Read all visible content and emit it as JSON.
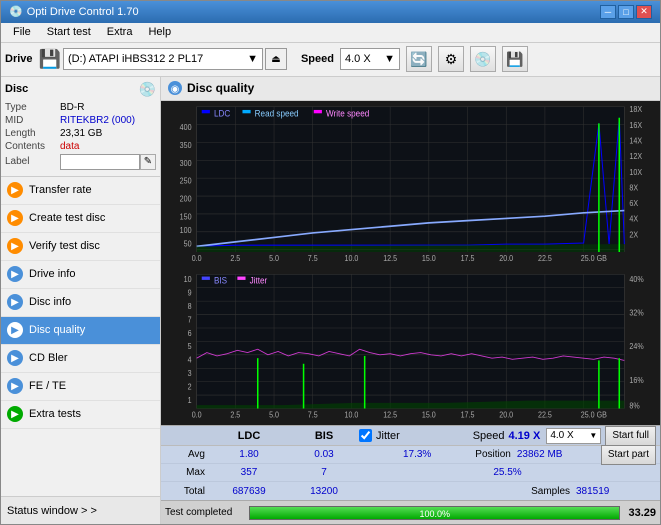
{
  "app": {
    "title": "Opti Drive Control 1.70",
    "icon": "💿"
  },
  "titlebar": {
    "minimize": "─",
    "maximize": "□",
    "close": "✕"
  },
  "menu": {
    "items": [
      "File",
      "Start test",
      "Extra",
      "Help"
    ]
  },
  "drivebar": {
    "drive_label": "Drive",
    "drive_value": "(D:) ATAPI iHBS312  2 PL17",
    "speed_label": "Speed",
    "speed_value": "4.0 X"
  },
  "disc": {
    "title": "Disc",
    "type_label": "Type",
    "type_value": "BD-R",
    "mid_label": "MID",
    "mid_value": "RITEKBR2 (000)",
    "length_label": "Length",
    "length_value": "23,31 GB",
    "contents_label": "Contents",
    "contents_value": "data",
    "label_label": "Label",
    "label_value": ""
  },
  "sidebar": {
    "items": [
      {
        "id": "transfer-rate",
        "label": "Transfer rate",
        "icon": "▶",
        "color": "orange"
      },
      {
        "id": "create-test-disc",
        "label": "Create test disc",
        "icon": "▶",
        "color": "orange"
      },
      {
        "id": "verify-test-disc",
        "label": "Verify test disc",
        "icon": "▶",
        "color": "orange"
      },
      {
        "id": "drive-info",
        "label": "Drive info",
        "icon": "▶",
        "color": "blue"
      },
      {
        "id": "disc-info",
        "label": "Disc info",
        "icon": "▶",
        "color": "blue"
      },
      {
        "id": "disc-quality",
        "label": "Disc quality",
        "icon": "▶",
        "color": "active",
        "active": true
      },
      {
        "id": "cd-bler",
        "label": "CD Bler",
        "icon": "▶",
        "color": "blue"
      },
      {
        "id": "fe-te",
        "label": "FE / TE",
        "icon": "▶",
        "color": "blue"
      },
      {
        "id": "extra-tests",
        "label": "Extra tests",
        "icon": "▶",
        "color": "green"
      }
    ],
    "status_window": "Status window > >"
  },
  "disc_quality": {
    "title": "Disc quality",
    "legend": {
      "ldc": "LDC",
      "read_speed": "Read speed",
      "write_speed": "Write speed",
      "bis": "BIS",
      "jitter": "Jitter"
    },
    "upper_chart": {
      "y_left_max": 400,
      "y_left_labels": [
        "400",
        "350",
        "300",
        "250",
        "200",
        "150",
        "100",
        "50"
      ],
      "y_right_labels": [
        "18X",
        "16X",
        "14X",
        "12X",
        "10X",
        "8X",
        "6X",
        "4X",
        "2X"
      ],
      "x_labels": [
        "0.0",
        "2.5",
        "5.0",
        "7.5",
        "10.0",
        "12.5",
        "15.0",
        "17.5",
        "20.0",
        "22.5",
        "25.0 GB"
      ]
    },
    "lower_chart": {
      "y_left_labels": [
        "10",
        "9",
        "8",
        "7",
        "6",
        "5",
        "4",
        "3",
        "2",
        "1"
      ],
      "y_right_labels": [
        "40%",
        "32%",
        "24%",
        "16%",
        "8%"
      ],
      "x_labels": [
        "0.0",
        "2.5",
        "5.0",
        "7.5",
        "10.0",
        "12.5",
        "15.0",
        "17.5",
        "20.0",
        "22.5",
        "25.0 GB"
      ]
    }
  },
  "stats": {
    "ldc_header": "LDC",
    "bis_header": "BIS",
    "jitter_label": "✓ Jitter",
    "speed_label": "Speed",
    "speed_value": "4.19 X",
    "speed_selector": "4.0 X",
    "avg_label": "Avg",
    "avg_ldc": "1.80",
    "avg_bis": "0.03",
    "avg_jitter": "17.3%",
    "max_label": "Max",
    "max_ldc": "357",
    "max_bis": "7",
    "max_jitter": "25.5%",
    "position_label": "Position",
    "position_value": "23862 MB",
    "total_label": "Total",
    "total_ldc": "687639",
    "total_bis": "13200",
    "samples_label": "Samples",
    "samples_value": "381519",
    "start_full": "Start full",
    "start_part": "Start part"
  },
  "bottom": {
    "status": "Test completed",
    "progress": 100.0,
    "progress_text": "100.0%",
    "score": "33.29"
  }
}
